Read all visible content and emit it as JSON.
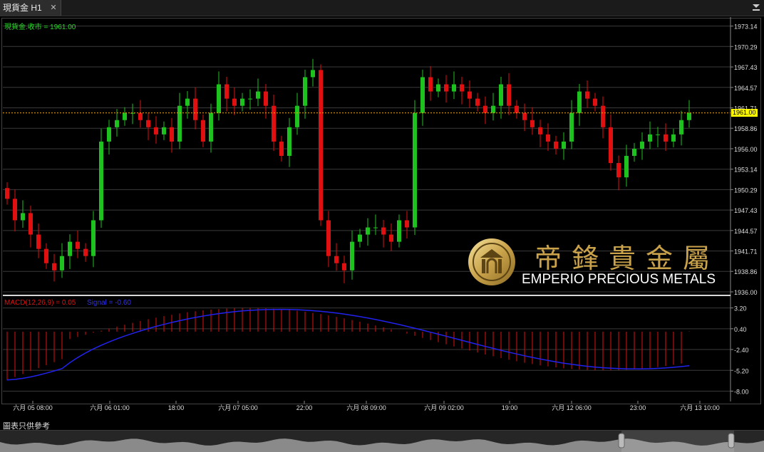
{
  "window": {
    "tab_title": "現貨金 H1"
  },
  "price_panel": {
    "legend_text": "現貨金.收市 = 1961.00",
    "current_price_label": "1961.00",
    "y_ticks": [
      "1973.14",
      "1970.29",
      "1967.43",
      "1964.57",
      "1961.71",
      "1958.86",
      "1956.00",
      "1953.14",
      "1950.29",
      "1947.43",
      "1944.57",
      "1941.71",
      "1938.86",
      "1936.00"
    ]
  },
  "macd_panel": {
    "legend_macd": "MACD(12,26,9) = 0.05",
    "legend_signal": "Signal = -0.60",
    "y_ticks": [
      "3.20",
      "0.40",
      "-2.40",
      "-5.20",
      "-8.00"
    ]
  },
  "x_axis": {
    "labels": [
      "六月 05 08:00",
      "六月 06 01:00",
      "18:00",
      "六月 07 05:00",
      "22:00",
      "六月 08 09:00",
      "六月 09 02:00",
      "19:00",
      "六月 12 06:00",
      "23:00",
      "六月 13 10:00"
    ]
  },
  "watermark": {
    "company_cn": "帝鋒貴金屬",
    "company_en": "EMPERIO PRECIOUS METALS"
  },
  "footer": {
    "disclaimer": "圖表只供參考"
  },
  "colors": {
    "up": "#1ec21e",
    "down": "#e01010",
    "signal": "#2222ee",
    "price_line": "#ffa500",
    "brand_gold": "#c9a24a"
  },
  "chart_data": {
    "type": "candlestick",
    "symbol": "現貨金",
    "timeframe": "H1",
    "ylim": [
      1936.0,
      1974.0
    ],
    "last_close": 1961.0,
    "close_approx": [
      1949,
      1946,
      1947,
      1944,
      1942,
      1940,
      1939,
      1941,
      1943,
      1942,
      1941,
      1946,
      1957,
      1959,
      1960,
      1961,
      1961,
      1960,
      1959,
      1958,
      1959,
      1957,
      1962,
      1963,
      1960,
      1957,
      1961,
      1965,
      1963,
      1962,
      1963,
      1963,
      1964,
      1962,
      1957,
      1955,
      1959,
      1962,
      1966,
      1967,
      1946,
      1941,
      1940,
      1939,
      1943,
      1944,
      1945,
      1945,
      1944,
      1943,
      1946,
      1945,
      1961,
      1966,
      1964,
      1965,
      1964,
      1965,
      1964,
      1963,
      1962,
      1961,
      1962,
      1965,
      1962,
      1961,
      1960,
      1959,
      1958,
      1957,
      1956,
      1957,
      1961,
      1964,
      1963,
      1962,
      1959,
      1954,
      1952,
      1955,
      1956,
      1957,
      1958,
      1958,
      1957,
      1958,
      1960,
      1961
    ],
    "macd": {
      "last": 0.05,
      "signal_last": -0.6,
      "ylim": [
        -8.0,
        4.0
      ]
    }
  }
}
